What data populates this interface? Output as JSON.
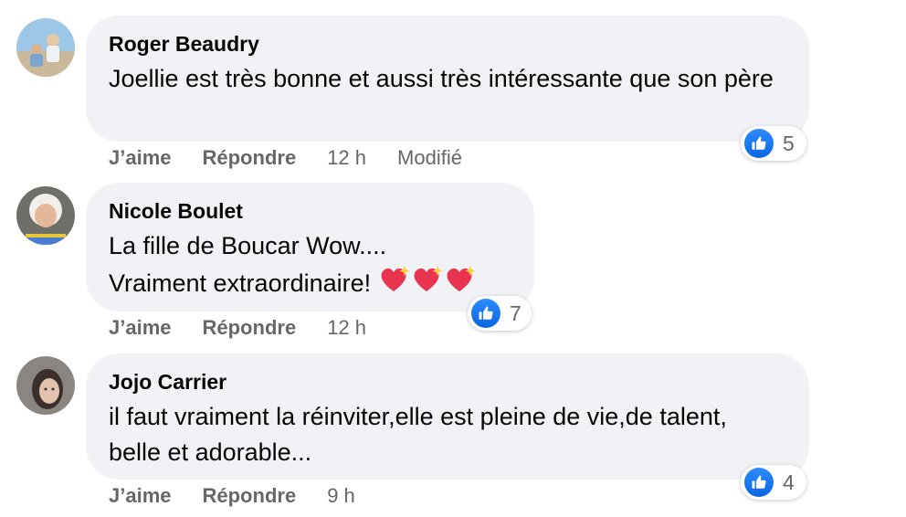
{
  "comments": [
    {
      "author": "Roger Beaudry",
      "text": "Joellie est très bonne et aussi très intéressante que son père",
      "like_label": "J’aime",
      "reply_label": "Répondre",
      "time": "12 h",
      "edited": "Modifié",
      "reaction_count": "5",
      "reaction_icon": "like-icon"
    },
    {
      "author": "Nicole Boulet",
      "text_line1": "La fille de Boucar Wow....",
      "text_line2": "Vraiment extraordinaire!",
      "emoji": "sparkling-heart x3",
      "like_label": "J’aime",
      "reply_label": "Répondre",
      "time": "12 h",
      "reaction_count": "7",
      "reaction_icon": "like-icon"
    },
    {
      "author": "Jojo Carrier",
      "text": "il faut vraiment la réinviter,elle est pleine de vie,de talent, belle et adorable...",
      "like_label": "J’aime",
      "reply_label": "Répondre",
      "time": "9 h",
      "reaction_count": "4",
      "reaction_icon": "like-icon"
    }
  ],
  "colors": {
    "bubble": "#f0f2f5",
    "meta_text": "#65676b",
    "like_blue": "#1877f2"
  }
}
